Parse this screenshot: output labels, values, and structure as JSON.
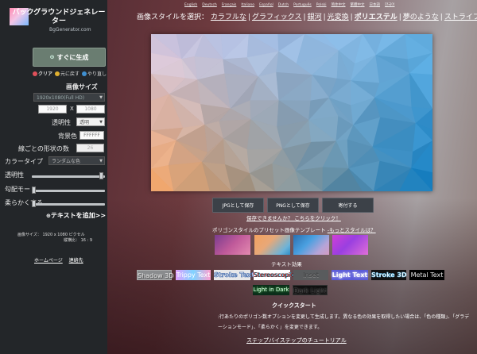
{
  "sidebar": {
    "logo_title": "バックグラウンドジェネレーター",
    "logo_sub": "BgGenerator.com",
    "generate_label": "すぐに生成",
    "clear_label": "クリア",
    "undo_label": "元に戻す",
    "redo_label": "やり直し",
    "size_label": "画像サイズ",
    "size_value": "1920x1080(Full HD)",
    "width_placeholder": "1920",
    "height_placeholder": "1080",
    "size_x": "X",
    "transparency_label": "透明性",
    "transparency_value": "透明",
    "bgcolor_label": "背景色",
    "bgcolor_value": "FFFFFF",
    "shapes_label": "線ごとの形状の数",
    "shapes_value": "26",
    "colortype_label": "カラータイプ",
    "colortype_value": "ランダムな色",
    "opacity_label": "透明性",
    "gradient_label": "勾配モード",
    "soften_label": "柔らかくする",
    "add_text_label": "テキストを追加>>",
    "info_line1": "画像サイズ： 1920 x 1080 ピクセル",
    "info_line2": "縦横比： 16 : 9",
    "homepage_link": "ホームページ",
    "contact_link": "連絡先",
    "opacity_level": 0.98,
    "gradient_level": 0.0,
    "soften_level": 0.0
  },
  "main": {
    "languages": [
      "English",
      "Deutsch",
      "Français",
      "Italiano",
      "Español",
      "Dutch",
      "Português",
      "Polski",
      "简体中文",
      "繁體中文",
      "日本語",
      "한국어"
    ],
    "style_prefix": "画像スタイルを選択：",
    "styles": [
      "カラフルな",
      "グラフィックス",
      "銀河",
      "光変換",
      "ポリエステル",
      "夢のような",
      "ストライプ"
    ],
    "current_style": "ポリエステル",
    "save_jpg": "JPGとして保存",
    "save_png": "PNGとして保存",
    "donate": "寄付する",
    "cannot_save": "保存できませんか？ こちらをクリック！",
    "template_title": "ポリゴンスタイルのプリセット画像テンプレート",
    "template_more": "-もっとスタイルは？",
    "text_effects_title": "テキスト効果",
    "text_effects": [
      "Shadow 3D",
      "Trippy Text",
      "Stroke Text",
      "Stereoscopic",
      "Inset",
      "Light Text",
      "Stroke 3D",
      "Metal Text",
      "Light in Dark",
      "Dark Light"
    ],
    "quickstart_title": "クイックスタート",
    "quickstart_text": ":行あたりのポリゴン数オプションを変更して生成します。異なる色の効果を取得したい場合は、「色の種類」、「グラデーションモード」、「柔らかく」を変更できます。",
    "tutorial_link": "ステップバイステップのチュートリアル"
  },
  "colors": {
    "sidebar_bg": "#232629",
    "generate_btn": "#6a7d71",
    "clear_dot": "#e0505a",
    "undo_dot": "#e0b030",
    "redo_dot": "#3f8fd0"
  }
}
